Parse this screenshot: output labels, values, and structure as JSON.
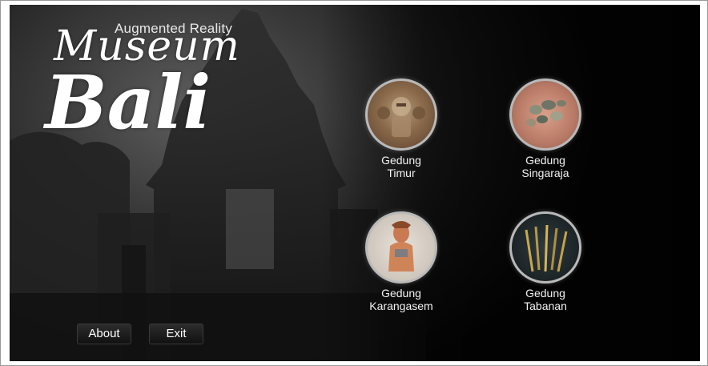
{
  "title": {
    "subtitle": "Augmented Reality",
    "line1": "Museum",
    "line2": "Bali"
  },
  "menu": [
    {
      "line1": "Gedung",
      "line2": "Timur",
      "icon": "carved-relief-icon"
    },
    {
      "line1": "Gedung",
      "line2": "Singaraja",
      "icon": "coins-icon"
    },
    {
      "line1": "Gedung",
      "line2": "Karangasem",
      "icon": "statue-icon"
    },
    {
      "line1": "Gedung",
      "line2": "Tabanan",
      "icon": "keris-icon"
    }
  ],
  "buttons": {
    "about": "About",
    "exit": "Exit"
  },
  "colors": {
    "background": "#0a0a0a",
    "text": "#ffffff",
    "circle_border": "#b9b9b9"
  }
}
